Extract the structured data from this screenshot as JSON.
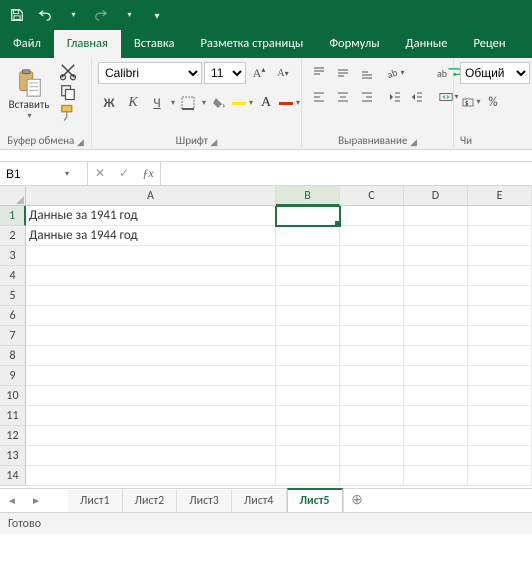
{
  "qat": {},
  "tabs": {
    "file": "Файл",
    "home": "Главная",
    "insert": "Вставка",
    "layout": "Разметка страницы",
    "formulas": "Формулы",
    "data": "Данные",
    "review": "Рецен"
  },
  "ribbon": {
    "clipboard": {
      "paste": "Вставить",
      "label": "Буфер обмена"
    },
    "font": {
      "name": "Calibri",
      "size": "11",
      "bold": "Ж",
      "italic": "К",
      "underline": "Ч",
      "label": "Шрифт"
    },
    "align": {
      "wrap": "ab",
      "label": "Выравнивание"
    },
    "number": {
      "format": "Общий",
      "label": "Чи"
    }
  },
  "name_box": "B1",
  "columns": [
    "A",
    "B",
    "C",
    "D",
    "E"
  ],
  "rows": [
    {
      "n": 1,
      "A": "Данные за 1941 год"
    },
    {
      "n": 2,
      "A": "Данные за 1944 год"
    },
    {
      "n": 3
    },
    {
      "n": 4
    },
    {
      "n": 5
    },
    {
      "n": 6
    },
    {
      "n": 7
    },
    {
      "n": 8
    },
    {
      "n": 9
    },
    {
      "n": 10
    },
    {
      "n": 11
    },
    {
      "n": 12
    },
    {
      "n": 13
    },
    {
      "n": 14
    }
  ],
  "active": {
    "row": 1,
    "col": "B"
  },
  "sheets": [
    "Лист1",
    "Лист2",
    "Лист3",
    "Лист4",
    "Лист5"
  ],
  "active_sheet": 4,
  "status": "Готово"
}
